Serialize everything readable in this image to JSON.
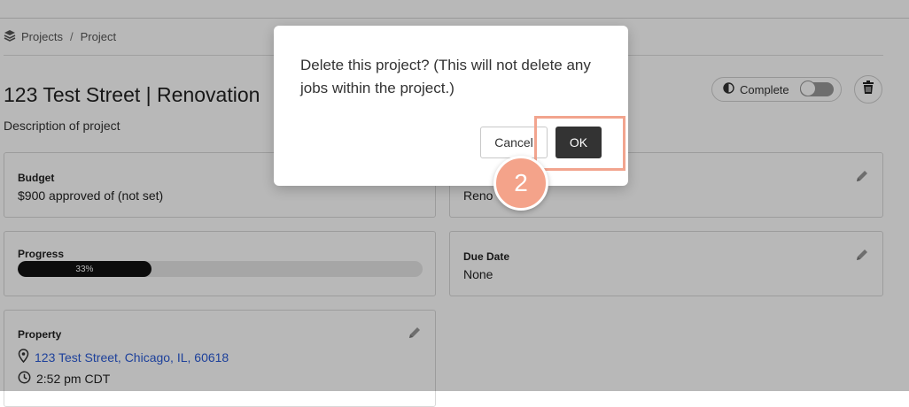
{
  "breadcrumb": {
    "items": [
      "Projects",
      "Project"
    ],
    "separator": "/"
  },
  "project": {
    "title": "123 Test Street | Renovation",
    "description": "Description of project"
  },
  "header_controls": {
    "complete_label": "Complete",
    "complete_toggle_on": false
  },
  "cards": {
    "budget": {
      "label": "Budget",
      "value": "$900 approved of (not set)"
    },
    "type": {
      "value": "Reno"
    },
    "progress": {
      "label": "Progress",
      "percent_text": "33%",
      "percent": 33
    },
    "due_date": {
      "label": "Due Date",
      "value": "None"
    },
    "property": {
      "label": "Property",
      "address": "123 Test Street, Chicago, IL, 60618",
      "time": "2:52 pm CDT"
    }
  },
  "dialog": {
    "message": "Delete this project? (This will not delete any jobs within the project.)",
    "cancel_label": "Cancel",
    "ok_label": "OK"
  },
  "annotation": {
    "step_number": "2"
  },
  "colors": {
    "accent_highlight": "#f2a48e",
    "step_badge": "#f4a38a",
    "link": "#2a5bd7",
    "ok_button": "#333333"
  },
  "icons": [
    "layers-icon",
    "half-circle-icon",
    "trash-icon",
    "pencil-icon",
    "map-pin-icon",
    "clock-icon"
  ]
}
